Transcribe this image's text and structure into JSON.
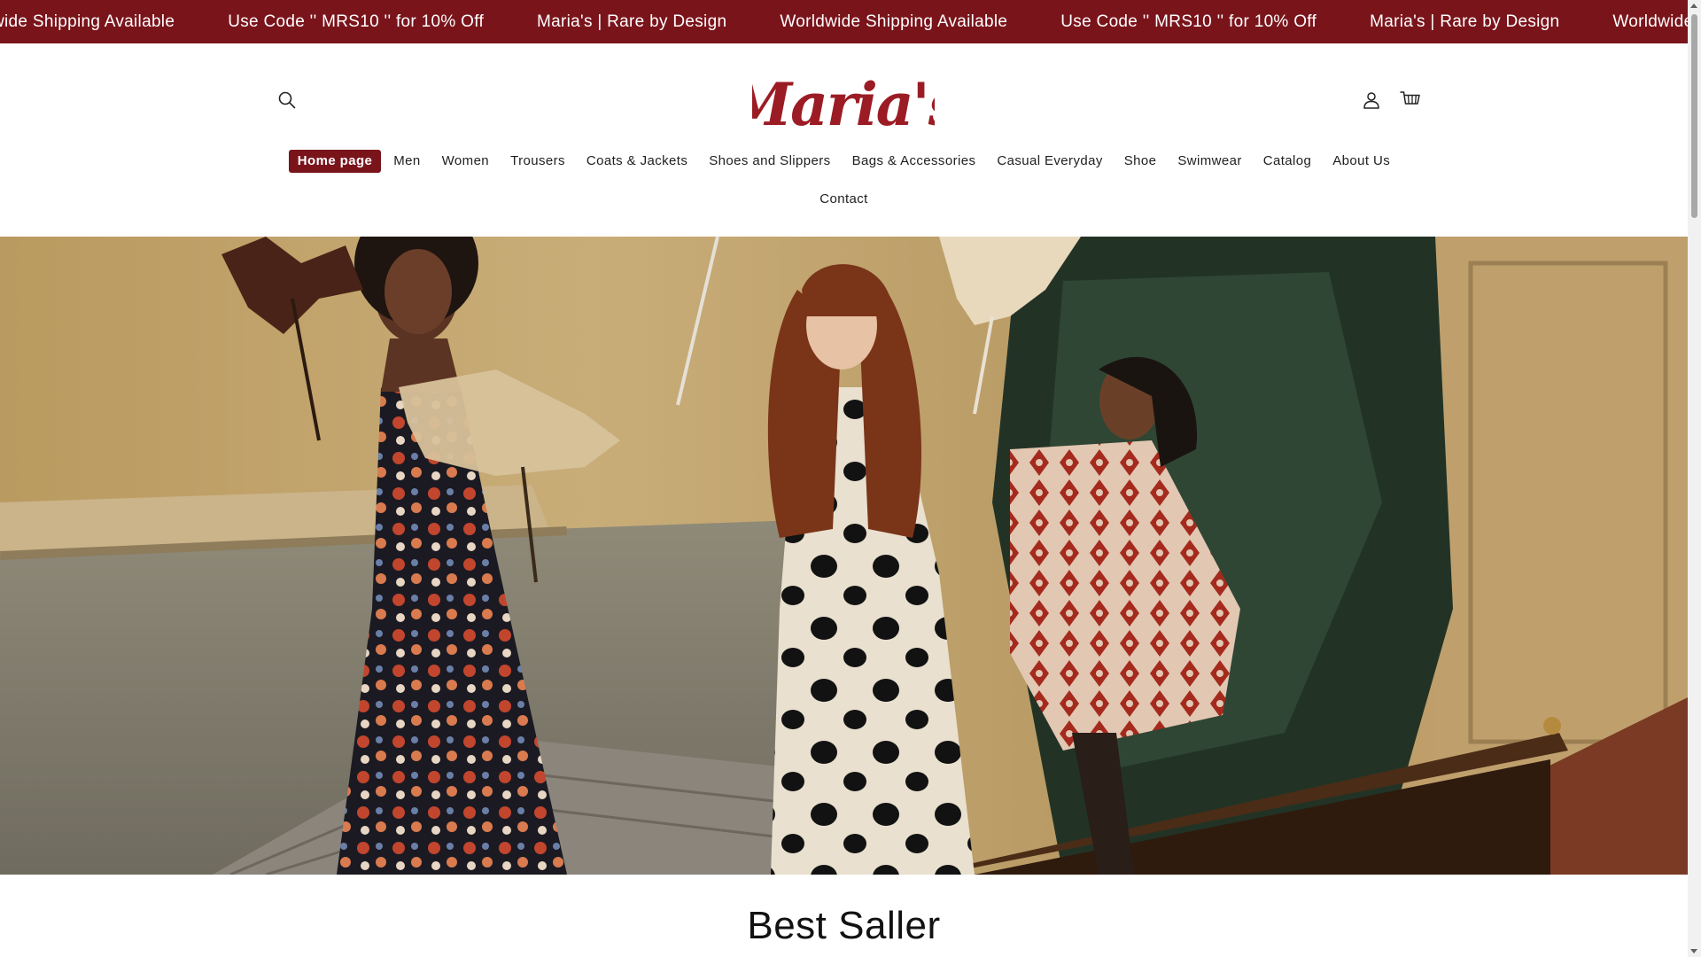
{
  "announcement": {
    "items": [
      "wide Shipping Available",
      "Use Code '' MRS10 '' for 10% Off",
      "Maria's | Rare by Design",
      "Worldwide Shipping Available",
      "Use Code '' MRS10 '' for 10% Off",
      "Maria's | Rare by Design",
      "Worldwide S"
    ],
    "background": "#7a141b"
  },
  "header": {
    "logo_text": "Maria's",
    "brand_color": "#9b1c24",
    "icons": {
      "search": "search-icon",
      "account": "user-icon",
      "cart": "cart-icon"
    }
  },
  "nav": {
    "items": [
      "Home page",
      "Men",
      "Women",
      "Trousers",
      "Coats & Jackets",
      "Shoes and Slippers",
      "Bags & Accessories",
      "Casual Everyday",
      "Shoe",
      "Swimwear",
      "Catalog",
      "About Us"
    ],
    "second_row": [
      "Contact"
    ],
    "active": "Home page",
    "active_color": "#7a141b"
  },
  "section": {
    "title": "Best Saller"
  }
}
